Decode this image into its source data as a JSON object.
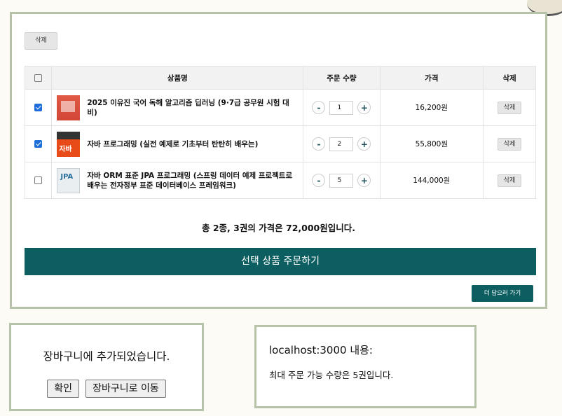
{
  "cart": {
    "delete_top_label": "삭제",
    "headers": {
      "name": "상품명",
      "qty": "주문 수량",
      "price": "가격",
      "delete": "삭제"
    },
    "items": [
      {
        "checked": true,
        "name": "2025 이유진 국어 독해 알고리즘 딥러닝 (9·7급 공무원 시험 대비)",
        "qty": "1",
        "price": "16,200원",
        "delete_label": "삭제"
      },
      {
        "checked": true,
        "name": "자바 프로그래밍 (실전 예제로 기초부터 탄탄히 배우는)",
        "qty": "2",
        "price": "55,800원",
        "delete_label": "삭제"
      },
      {
        "checked": false,
        "name": "자바 ORM 표준 JPA 프로그래밍 (스프링 데이터 예제 프로젝트로 배우는 전자정부 표준 데이터베이스 프레임워크)",
        "qty": "5",
        "price": "144,000원",
        "delete_label": "삭제"
      }
    ],
    "qty_minus": "-",
    "qty_plus": "+",
    "total_text": "총 2종, 3권의 가격은 72,000원입니다.",
    "order_button": "선택 상품 주문하기",
    "more_button": "더 담으러 가기"
  },
  "dialog_added": {
    "message": "장바구니에 추가되었습니다.",
    "confirm": "확인",
    "go_cart": "장바구니로 이동"
  },
  "dialog_alert": {
    "title": "localhost:3000 내용:",
    "message": "최대 주문 가능 수량은 5권입니다."
  }
}
